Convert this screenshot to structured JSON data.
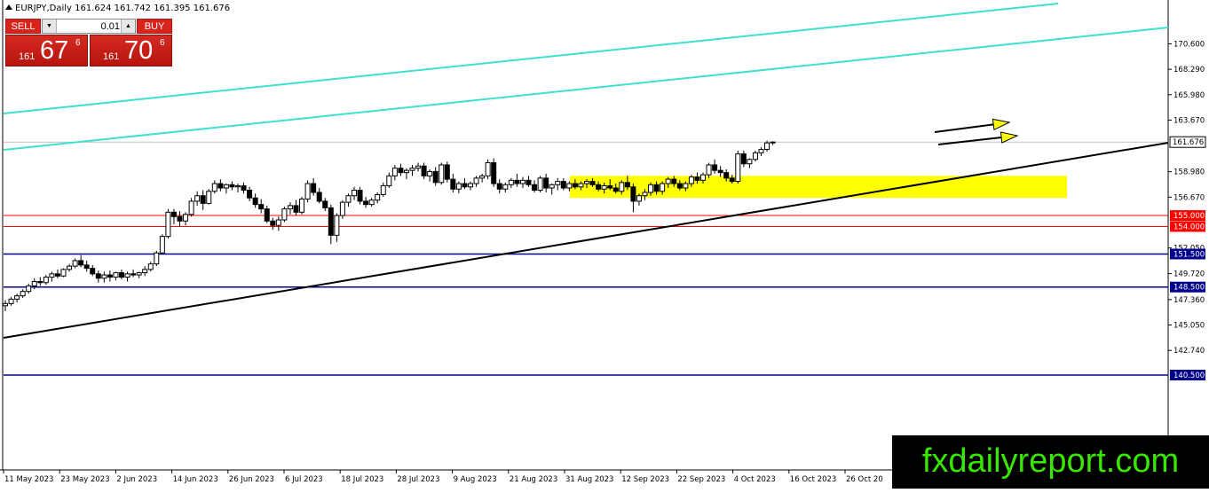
{
  "window": {
    "symbol_title": "EURJPY,Daily",
    "ohlc": "161.624 161.742 161.395 161.676"
  },
  "trade_panel": {
    "sell_label": "SELL",
    "buy_label": "BUY",
    "lot_value": "0.01",
    "down_arrow": "▼",
    "up_arrow": "▲",
    "sell_price_prefix": "161",
    "sell_price_main": "67",
    "sell_price_sup": "6",
    "buy_price_prefix": "161",
    "buy_price_main": "70",
    "buy_price_sup": "6"
  },
  "watermark": "fxdailyreport.com",
  "colors": {
    "channel_line": "#40e0d0",
    "support_line": "#000000",
    "zone_fill": "#ffff00",
    "red_level": "#ff0000",
    "blue_level": "#00008b",
    "current_price_bg": "#ffffff",
    "level_label_red_bg": "#ff0000",
    "level_label_blue_bg": "#00008b",
    "arrow": "#ffff00",
    "watermark_text": "#39e600"
  },
  "chart_data": {
    "type": "candlestick",
    "title": "EURJPY,Daily",
    "y_ticks": [
      "170.600",
      "168.290",
      "165.980",
      "163.670",
      "161.676",
      "158.980",
      "156.670",
      "154.000",
      "152.050",
      "149.720",
      "147.360",
      "145.050",
      "142.740",
      "140.500"
    ],
    "ylim": [
      138.1,
      172.6
    ],
    "x_labels": [
      "11 May 2023",
      "23 May 2023",
      "2 Jun 2023",
      "14 Jun 2023",
      "26 Jun 2023",
      "6 Jul 2023",
      "18 Jul 2023",
      "28 Jul 2023",
      "9 Aug 2023",
      "21 Aug 2023",
      "31 Aug 2023",
      "12 Sep 2023",
      "22 Sep 2023",
      "4 Oct 2023",
      "16 Oct 2023",
      "26 Oct 20"
    ],
    "current_price": 161.676,
    "horizontal_levels": [
      {
        "price": 155.0,
        "label": "155.000",
        "color": "red"
      },
      {
        "price": 154.0,
        "label": "154.000",
        "color": "red"
      },
      {
        "price": 151.5,
        "label": "151.500",
        "color": "blue"
      },
      {
        "price": 148.5,
        "label": "148.500",
        "color": "blue"
      },
      {
        "price": 140.5,
        "label": "140.500",
        "color": "blue"
      }
    ],
    "trend_lines": [
      {
        "name": "channel-upper",
        "from": [
          "11 May 2023",
          167.3
        ],
        "to": [
          "26 Oct 2023",
          173.0
        ]
      },
      {
        "name": "channel-lower",
        "from": [
          "11 May 2023",
          161.0
        ],
        "to": [
          "end",
          170.8
        ]
      },
      {
        "name": "support",
        "from": [
          "11 May 2023",
          146.3
        ],
        "to": [
          "end",
          161.6
        ]
      }
    ],
    "zone": {
      "price_high": 158.6,
      "price_low": 156.6,
      "from": "31 Aug 2023",
      "to": "after 26 Oct 2023"
    },
    "candles": [
      [
        146.8,
        147.3,
        146.3,
        147.0
      ],
      [
        147.0,
        147.6,
        146.8,
        147.4
      ],
      [
        147.4,
        147.9,
        147.1,
        147.7
      ],
      [
        147.7,
        148.3,
        147.5,
        148.1
      ],
      [
        148.1,
        148.8,
        147.9,
        148.6
      ],
      [
        148.6,
        149.3,
        148.3,
        149.0
      ],
      [
        149.0,
        149.4,
        148.6,
        148.9
      ],
      [
        148.9,
        149.6,
        148.7,
        149.4
      ],
      [
        149.4,
        149.9,
        149.0,
        149.7
      ],
      [
        149.7,
        150.1,
        149.3,
        149.5
      ],
      [
        149.5,
        150.2,
        149.4,
        150.1
      ],
      [
        150.1,
        150.6,
        149.9,
        150.4
      ],
      [
        150.4,
        151.1,
        150.2,
        150.9
      ],
      [
        150.9,
        151.4,
        150.3,
        150.5
      ],
      [
        150.5,
        150.9,
        149.9,
        150.2
      ],
      [
        150.2,
        150.5,
        149.5,
        149.7
      ],
      [
        149.7,
        150.0,
        148.9,
        149.3
      ],
      [
        149.3,
        149.9,
        148.9,
        149.6
      ],
      [
        149.6,
        150.0,
        149.0,
        149.4
      ],
      [
        149.4,
        149.9,
        149.1,
        149.8
      ],
      [
        149.8,
        150.1,
        149.2,
        149.4
      ],
      [
        149.4,
        149.9,
        149.0,
        149.7
      ],
      [
        149.7,
        150.1,
        149.4,
        149.6
      ],
      [
        149.6,
        149.9,
        149.3,
        149.8
      ],
      [
        149.8,
        150.4,
        149.5,
        150.1
      ],
      [
        150.1,
        150.8,
        149.9,
        150.6
      ],
      [
        150.6,
        151.8,
        150.4,
        151.6
      ],
      [
        151.6,
        153.3,
        151.5,
        153.1
      ],
      [
        153.1,
        155.6,
        152.9,
        155.3
      ],
      [
        155.3,
        155.6,
        154.2,
        154.9
      ],
      [
        154.9,
        155.4,
        154.0,
        154.5
      ],
      [
        154.5,
        155.3,
        154.1,
        155.1
      ],
      [
        155.1,
        156.6,
        154.9,
        156.3
      ],
      [
        156.3,
        157.2,
        155.9,
        156.8
      ],
      [
        156.8,
        157.3,
        155.5,
        156.1
      ],
      [
        156.1,
        157.4,
        156.0,
        157.2
      ],
      [
        157.2,
        158.2,
        157.0,
        157.9
      ],
      [
        157.9,
        158.3,
        157.2,
        157.5
      ],
      [
        157.5,
        157.9,
        157.0,
        157.8
      ],
      [
        157.8,
        158.1,
        157.3,
        157.6
      ],
      [
        157.6,
        157.9,
        157.1,
        157.7
      ],
      [
        157.7,
        158.0,
        157.0,
        157.3
      ],
      [
        157.3,
        157.6,
        156.3,
        156.6
      ],
      [
        156.6,
        157.0,
        155.7,
        156.0
      ],
      [
        156.0,
        156.5,
        155.2,
        155.6
      ],
      [
        155.6,
        155.9,
        154.3,
        154.5
      ],
      [
        154.5,
        154.8,
        153.7,
        154.1
      ],
      [
        154.1,
        154.9,
        153.6,
        154.6
      ],
      [
        154.6,
        155.8,
        154.4,
        155.6
      ],
      [
        155.6,
        156.2,
        155.1,
        155.9
      ],
      [
        155.9,
        156.4,
        155.0,
        155.3
      ],
      [
        155.3,
        156.7,
        155.1,
        156.5
      ],
      [
        156.5,
        158.2,
        156.2,
        157.9
      ],
      [
        157.9,
        158.4,
        156.8,
        157.1
      ],
      [
        157.1,
        157.5,
        156.1,
        156.3
      ],
      [
        156.3,
        156.6,
        155.4,
        155.7
      ],
      [
        155.7,
        156.0,
        152.4,
        153.2
      ],
      [
        153.2,
        155.2,
        152.6,
        155.0
      ],
      [
        155.0,
        156.4,
        154.7,
        156.2
      ],
      [
        156.2,
        157.0,
        155.8,
        156.8
      ],
      [
        156.8,
        157.6,
        156.4,
        157.3
      ],
      [
        157.3,
        157.6,
        156.0,
        156.3
      ],
      [
        156.3,
        156.7,
        155.7,
        156.0
      ],
      [
        156.0,
        156.6,
        155.8,
        156.4
      ],
      [
        156.4,
        157.1,
        156.1,
        156.9
      ],
      [
        156.9,
        158.0,
        156.7,
        157.7
      ],
      [
        157.7,
        158.9,
        157.5,
        158.6
      ],
      [
        158.6,
        159.6,
        158.2,
        159.3
      ],
      [
        159.3,
        159.7,
        158.6,
        158.9
      ],
      [
        158.9,
        159.3,
        158.3,
        159.1
      ],
      [
        159.1,
        159.6,
        158.6,
        159.3
      ],
      [
        159.3,
        159.8,
        159.0,
        159.5
      ],
      [
        159.5,
        159.8,
        158.3,
        158.6
      ],
      [
        158.6,
        159.2,
        158.1,
        159.0
      ],
      [
        159.0,
        159.4,
        157.7,
        158.0
      ],
      [
        158.0,
        159.8,
        157.8,
        159.6
      ],
      [
        159.6,
        159.9,
        158.0,
        158.3
      ],
      [
        158.3,
        158.8,
        157.1,
        157.4
      ],
      [
        157.4,
        158.1,
        157.0,
        157.9
      ],
      [
        157.9,
        158.4,
        157.4,
        157.6
      ],
      [
        157.6,
        158.1,
        157.3,
        157.9
      ],
      [
        157.9,
        158.6,
        157.6,
        158.4
      ],
      [
        158.4,
        158.8,
        158.0,
        158.6
      ],
      [
        158.6,
        160.1,
        158.3,
        159.8
      ],
      [
        159.8,
        160.2,
        157.6,
        157.9
      ],
      [
        157.9,
        158.3,
        157.0,
        157.4
      ],
      [
        157.4,
        158.0,
        157.1,
        157.8
      ],
      [
        157.8,
        158.4,
        157.5,
        158.2
      ],
      [
        158.2,
        158.8,
        157.6,
        157.9
      ],
      [
        157.9,
        158.5,
        157.5,
        158.2
      ],
      [
        158.2,
        158.6,
        157.6,
        157.8
      ],
      [
        157.8,
        158.2,
        157.1,
        157.3
      ],
      [
        157.3,
        158.6,
        157.1,
        158.4
      ],
      [
        158.4,
        158.8,
        157.1,
        157.5
      ],
      [
        157.5,
        157.9,
        156.9,
        157.8
      ],
      [
        157.8,
        158.4,
        157.3,
        158.1
      ],
      [
        158.1,
        158.4,
        157.3,
        157.5
      ],
      [
        157.5,
        158.1,
        157.2,
        157.9
      ],
      [
        157.9,
        158.3,
        157.4,
        157.6
      ],
      [
        157.6,
        158.1,
        157.3,
        157.9
      ],
      [
        157.9,
        158.3,
        157.5,
        158.1
      ],
      [
        158.1,
        158.4,
        157.6,
        157.8
      ],
      [
        157.8,
        158.1,
        157.2,
        157.4
      ],
      [
        157.4,
        158.0,
        157.0,
        157.7
      ],
      [
        157.7,
        158.3,
        157.3,
        157.5
      ],
      [
        157.5,
        157.9,
        157.0,
        157.2
      ],
      [
        157.2,
        158.2,
        156.9,
        158.0
      ],
      [
        158.0,
        158.6,
        157.3,
        157.6
      ],
      [
        157.6,
        157.9,
        155.3,
        156.3
      ],
      [
        156.3,
        157.0,
        155.9,
        156.8
      ],
      [
        156.8,
        157.4,
        156.4,
        157.1
      ],
      [
        157.1,
        158.0,
        156.8,
        157.8
      ],
      [
        157.8,
        158.1,
        156.9,
        157.2
      ],
      [
        157.2,
        158.1,
        156.9,
        157.9
      ],
      [
        157.9,
        158.5,
        157.5,
        158.3
      ],
      [
        158.3,
        158.6,
        157.6,
        157.9
      ],
      [
        157.9,
        158.2,
        157.3,
        157.5
      ],
      [
        157.5,
        158.1,
        157.2,
        157.9
      ],
      [
        157.9,
        158.7,
        157.6,
        158.5
      ],
      [
        158.5,
        158.9,
        157.9,
        158.2
      ],
      [
        158.2,
        158.9,
        157.9,
        158.7
      ],
      [
        158.7,
        159.8,
        158.4,
        159.6
      ],
      [
        159.6,
        160.1,
        158.8,
        159.1
      ],
      [
        159.1,
        159.5,
        158.5,
        158.9
      ],
      [
        158.9,
        159.2,
        158.1,
        158.4
      ],
      [
        158.4,
        158.7,
        157.9,
        158.1
      ],
      [
        158.1,
        160.9,
        157.9,
        160.6
      ],
      [
        160.6,
        160.9,
        159.4,
        159.7
      ],
      [
        159.7,
        160.2,
        159.3,
        160.1
      ],
      [
        160.1,
        160.9,
        159.9,
        160.7
      ],
      [
        160.7,
        161.2,
        160.4,
        161.0
      ],
      [
        161.0,
        161.8,
        160.8,
        161.6
      ],
      [
        161.624,
        161.742,
        161.395,
        161.676
      ]
    ]
  }
}
